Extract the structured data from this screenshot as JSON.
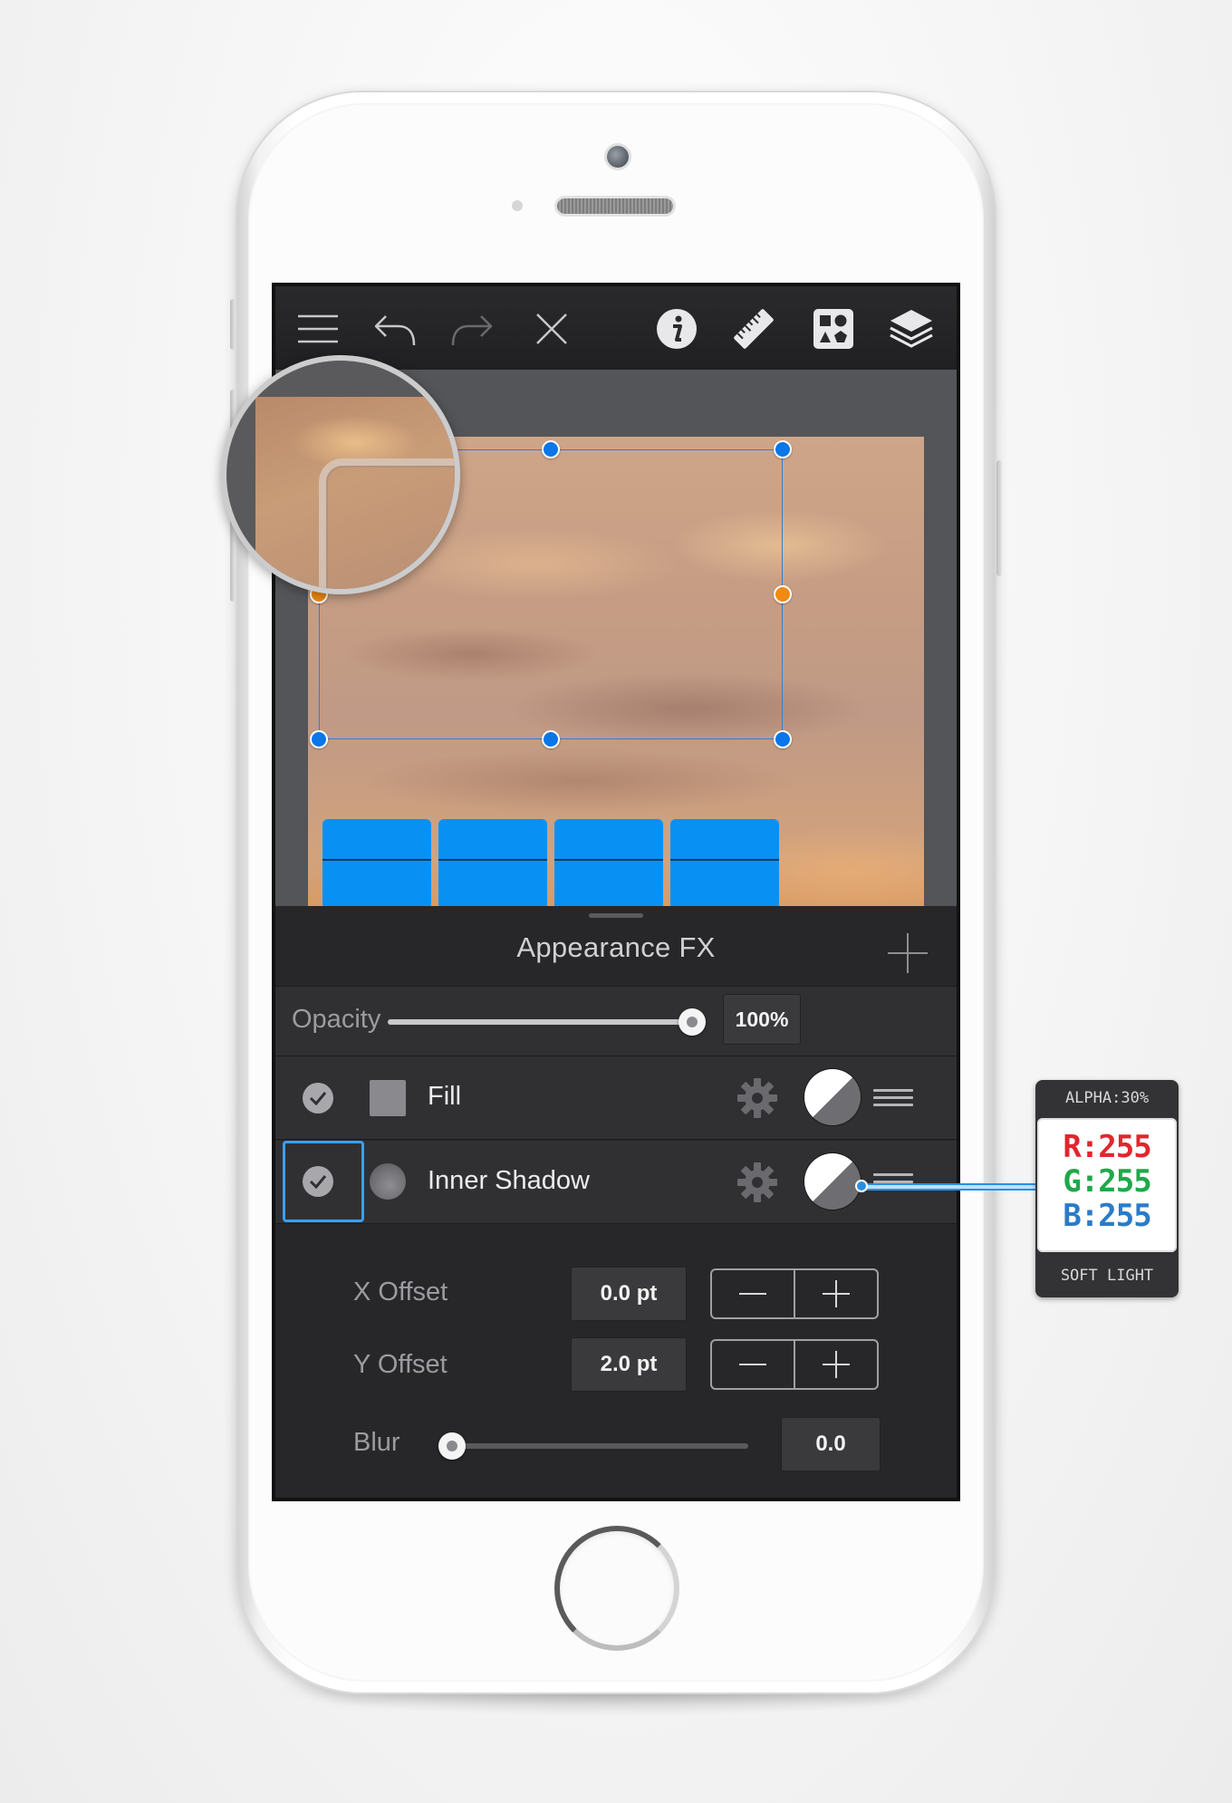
{
  "panel": {
    "title": "Appearance FX",
    "opacity": {
      "label": "Opacity",
      "value": "100%",
      "level": 1.0
    }
  },
  "effects": [
    {
      "label": "Fill",
      "enabled": true
    },
    {
      "label": "Inner Shadow",
      "enabled": true,
      "selected": true
    }
  ],
  "inner_shadow": {
    "x_offset": {
      "label": "X Offset",
      "value": "0.0 pt"
    },
    "y_offset": {
      "label": "Y Offset",
      "value": "2.0 pt"
    },
    "blur": {
      "label": "Blur",
      "value": "0.0",
      "level": 0.0
    }
  },
  "color_callout": {
    "alpha": "ALPHA:30%",
    "r": "R:255",
    "g": "G:255",
    "b": "B:255",
    "blend_mode": "SOFT LIGHT"
  },
  "colors": {
    "accent": "#0a76e8",
    "handle_mid": "#f08a12",
    "panel_bg": "#27272a",
    "toolbar_bg": "#2a2a2c",
    "r_text": "#e0262e",
    "g_text": "#1fa84a",
    "b_text": "#2a7cc8"
  },
  "toolbar_icons": [
    "menu-icon",
    "undo-icon",
    "redo-icon",
    "close-icon",
    "info-icon",
    "ruler-icon",
    "shapes-icon",
    "layers-icon"
  ]
}
